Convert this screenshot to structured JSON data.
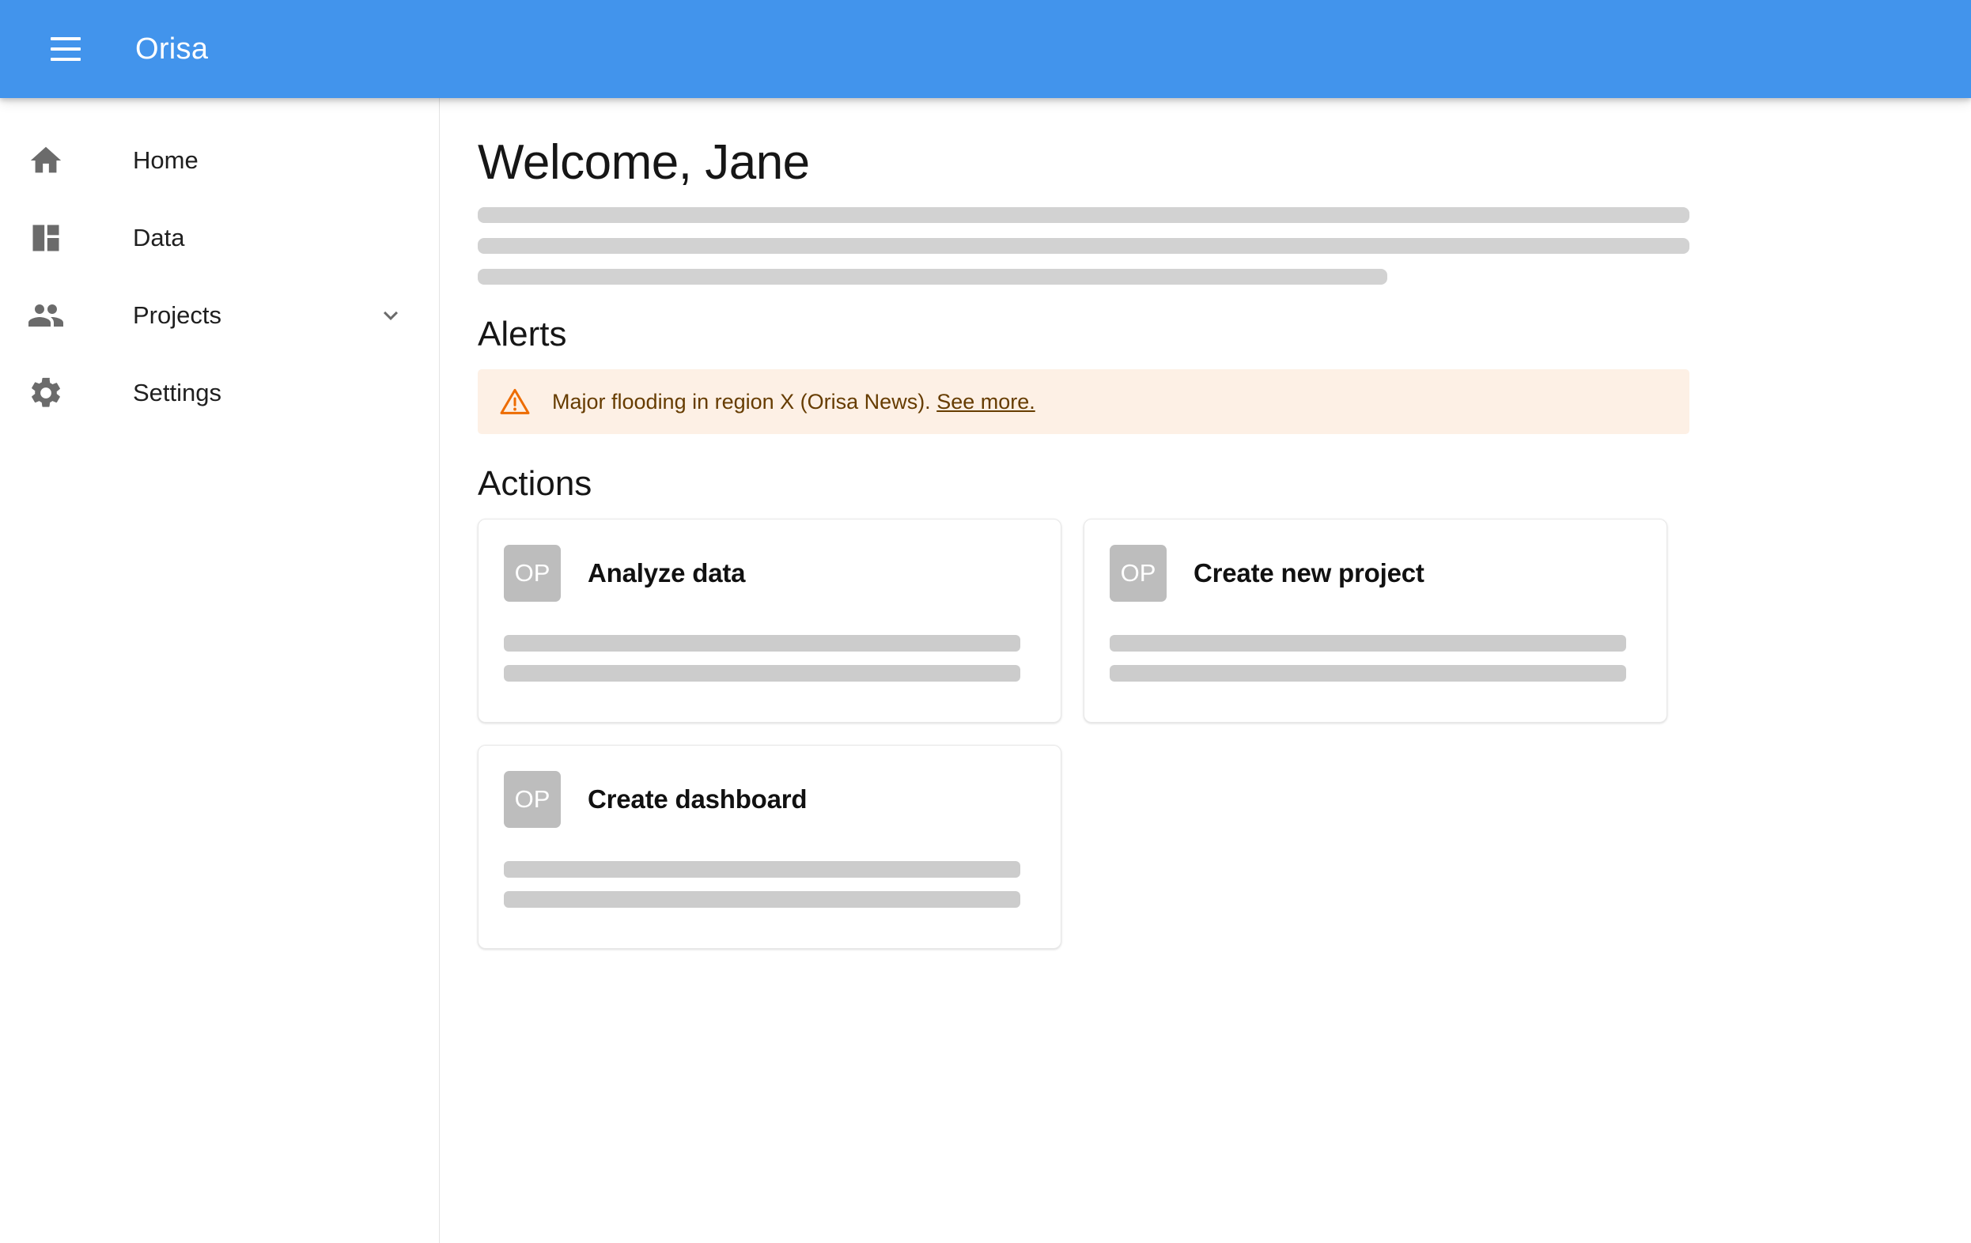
{
  "appbar": {
    "title": "Orisa",
    "menu_icon": "hamburger-menu-icon",
    "background_color": "#4294EC"
  },
  "sidebar": {
    "items": [
      {
        "label": "Home",
        "icon": "home-icon",
        "expandable": false
      },
      {
        "label": "Data",
        "icon": "dashboard-icon",
        "expandable": false
      },
      {
        "label": "Projects",
        "icon": "people-icon",
        "expandable": true,
        "expand_icon": "chevron-down-icon"
      },
      {
        "label": "Settings",
        "icon": "gear-icon",
        "expandable": false
      }
    ]
  },
  "main": {
    "page_title": "Welcome, Jane",
    "intro_placeholder_lines": [
      "100%",
      "100%",
      "75%"
    ],
    "alerts": {
      "section_title": "Alerts",
      "severity": "warning",
      "icon": "warning-triangle-icon",
      "background_color": "#FDF0E5",
      "text_color": "#663C00",
      "icon_color": "#ED6C02",
      "message": "Major flooding in region X (Orisa News).",
      "link_label": "See more."
    },
    "actions": {
      "section_title": "Actions",
      "cards": [
        {
          "avatar_initials": "OP",
          "title": "Analyze data",
          "placeholder_lines": 2
        },
        {
          "avatar_initials": "OP",
          "title": "Create new project",
          "placeholder_lines": 2
        },
        {
          "avatar_initials": "OP",
          "title": "Create dashboard",
          "placeholder_lines": 2
        }
      ]
    }
  }
}
